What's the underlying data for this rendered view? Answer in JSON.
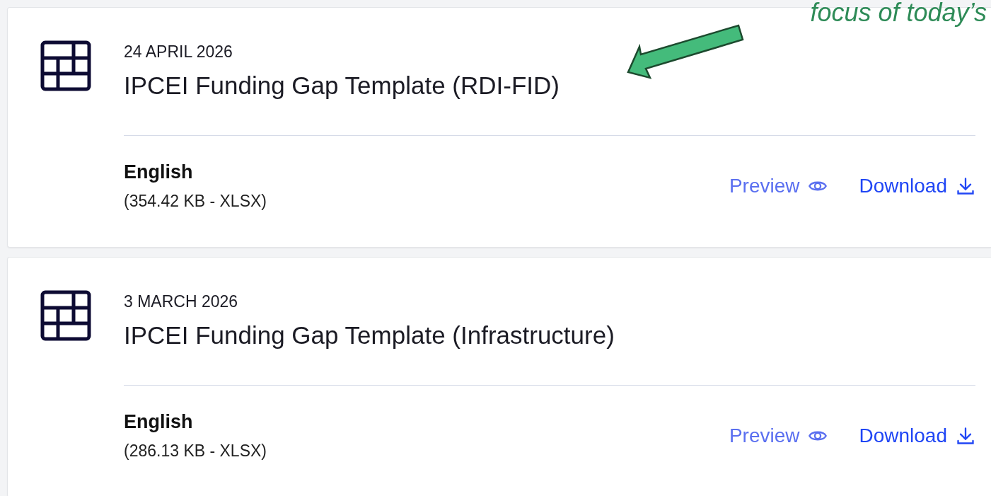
{
  "annotation": {
    "text": "focus of today’s"
  },
  "documents": [
    {
      "date": "24 APRIL 2026",
      "title": "IPCEI Funding Gap Template (RDI-FID)",
      "language": "English",
      "file_info": "(354.42 KB - XLSX)",
      "preview": "Preview",
      "download": "Download"
    },
    {
      "date": "3 MARCH 2026",
      "title": "IPCEI Funding Gap Template (Infrastructure)",
      "language": "English",
      "file_info": "(286.13 KB - XLSX)",
      "preview": "Preview",
      "download": "Download"
    }
  ]
}
